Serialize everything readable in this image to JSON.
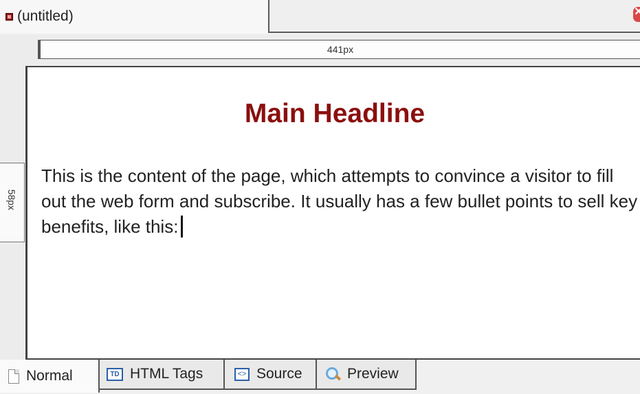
{
  "document_tab": {
    "title": "(untitled)"
  },
  "rulers": {
    "horizontal": "441px",
    "vertical": "58px"
  },
  "editor": {
    "headline": "Main Headline",
    "content": "This is the content of the page, which attempts to convince a visitor to fill out the web form and subscribe. It usually has a few bullet points to sell key benefits, like this:"
  },
  "view_tabs": [
    {
      "label": "Normal",
      "icon": "page-icon"
    },
    {
      "label": "HTML Tags",
      "icon": "td-icon"
    },
    {
      "label": "Source",
      "icon": "source-code-icon"
    },
    {
      "label": "Preview",
      "icon": "magnifier-icon"
    }
  ],
  "colors": {
    "headline": "#8b0f0f",
    "icon_blue": "#2a5fa8"
  }
}
